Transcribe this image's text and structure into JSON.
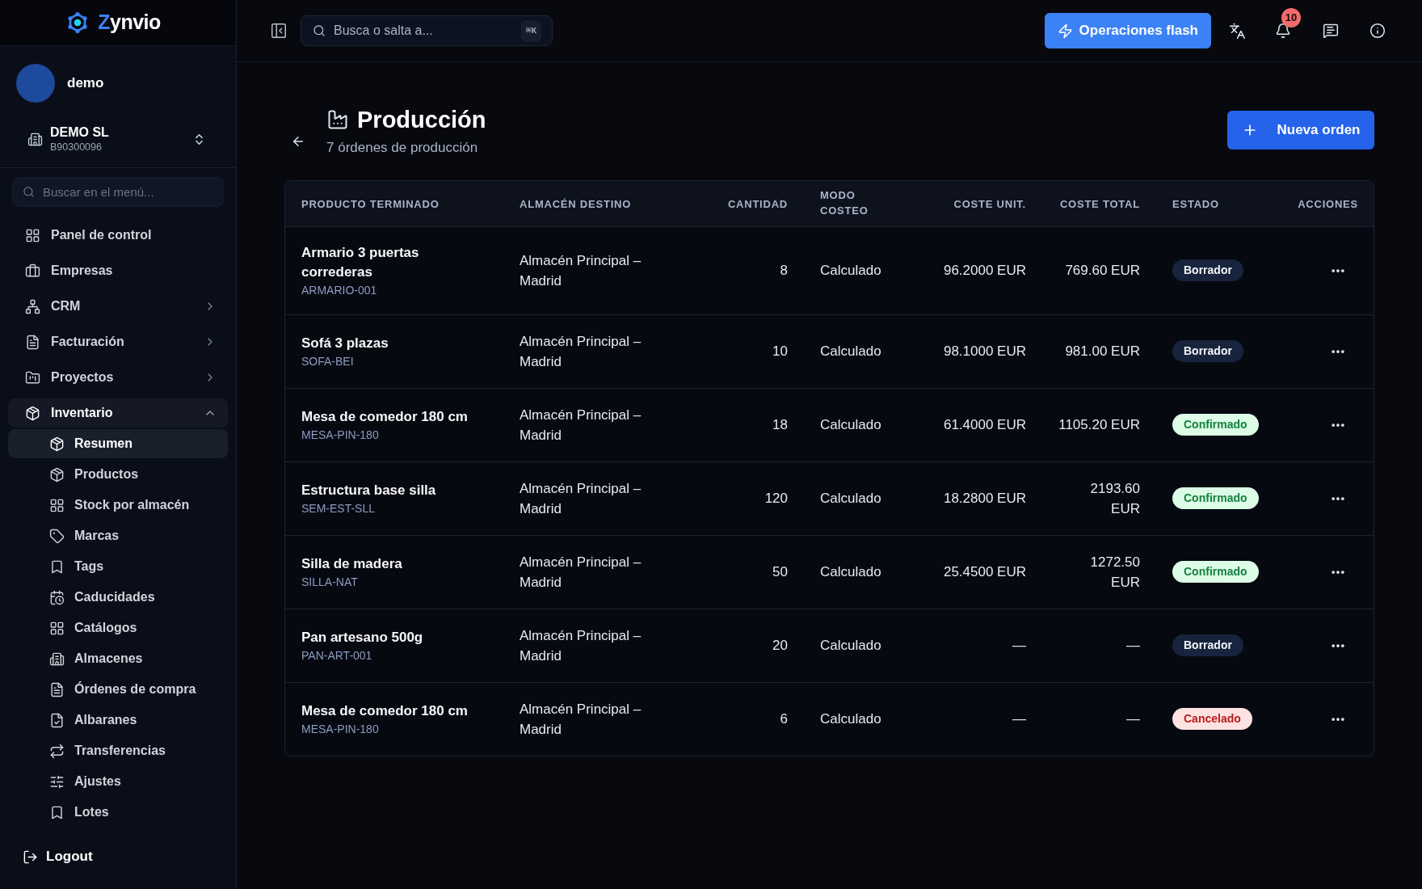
{
  "sidebar": {
    "logo": {
      "accent": "Z",
      "rest": "ynvio"
    },
    "user": {
      "name": "demo"
    },
    "company": {
      "name": "DEMO SL",
      "tax_id": "B90300096"
    },
    "search": {
      "placeholder": "Buscar en el menú..."
    },
    "items": [
      {
        "label": "Panel de control",
        "selected": false
      },
      {
        "label": "Empresas",
        "selected": false
      },
      {
        "label": "CRM",
        "selected": false,
        "expanded": false
      },
      {
        "label": "Facturación",
        "selected": false,
        "expanded": false
      },
      {
        "label": "Proyectos",
        "selected": false,
        "expanded": false
      },
      {
        "label": "Inventario",
        "selected": true,
        "expanded": true,
        "children": [
          {
            "label": "Resumen",
            "selected": true
          },
          {
            "label": "Productos",
            "selected": false
          },
          {
            "label": "Stock por almacén",
            "selected": false
          },
          {
            "label": "Marcas",
            "selected": false
          },
          {
            "label": "Tags",
            "selected": false
          },
          {
            "label": "Caducidades",
            "selected": false
          },
          {
            "label": "Catálogos",
            "selected": false
          },
          {
            "label": "Almacenes",
            "selected": false
          },
          {
            "label": "Órdenes de compra",
            "selected": false
          },
          {
            "label": "Albaranes",
            "selected": false
          },
          {
            "label": "Transferencias",
            "selected": false
          },
          {
            "label": "Ajustes",
            "selected": false
          },
          {
            "label": "Lotes",
            "selected": false
          }
        ]
      }
    ],
    "logout": "Logout"
  },
  "topbar": {
    "search": {
      "placeholder": "Busca o salta a...",
      "shortcut": "⌘K"
    },
    "flash_button": "Operaciones flash",
    "notifications": {
      "count": "10"
    }
  },
  "page": {
    "title": "Producción",
    "subtitle": "7 órdenes de producción",
    "new_button": "Nueva orden"
  },
  "table": {
    "columns": [
      "PRODUCTO TERMINADO",
      "ALMACÉN DESTINO",
      "CANTIDAD",
      "MODO COSTEO",
      "COSTE UNIT.",
      "COSTE TOTAL",
      "ESTADO",
      "ACCIONES"
    ],
    "rows": [
      {
        "product": "Armario 3 puertas correderas",
        "sku": "ARMARIO-001",
        "warehouse": "Almacén Principal – Madrid",
        "quantity": "8",
        "costing_mode": "Calculado",
        "unit_cost": "96.2000 EUR",
        "total_cost": "769.60 EUR",
        "status": {
          "label": "Borrador",
          "kind": "draft"
        }
      },
      {
        "product": "Sofá 3 plazas",
        "sku": "SOFA-BEI",
        "warehouse": "Almacén Principal – Madrid",
        "quantity": "10",
        "costing_mode": "Calculado",
        "unit_cost": "98.1000 EUR",
        "total_cost": "981.00 EUR",
        "status": {
          "label": "Borrador",
          "kind": "draft"
        }
      },
      {
        "product": "Mesa de comedor 180 cm",
        "sku": "MESA-PIN-180",
        "warehouse": "Almacén Principal – Madrid",
        "quantity": "18",
        "costing_mode": "Calculado",
        "unit_cost": "61.4000 EUR",
        "total_cost": "1105.20 EUR",
        "status": {
          "label": "Confirmado",
          "kind": "confirmed"
        }
      },
      {
        "product": "Estructura base silla",
        "sku": "SEM-EST-SLL",
        "warehouse": "Almacén Principal – Madrid",
        "quantity": "120",
        "costing_mode": "Calculado",
        "unit_cost": "18.2800 EUR",
        "total_cost": "2193.60 EUR",
        "status": {
          "label": "Confirmado",
          "kind": "confirmed"
        }
      },
      {
        "product": "Silla de madera",
        "sku": "SILLA-NAT",
        "warehouse": "Almacén Principal – Madrid",
        "quantity": "50",
        "costing_mode": "Calculado",
        "unit_cost": "25.4500 EUR",
        "total_cost": "1272.50 EUR",
        "status": {
          "label": "Confirmado",
          "kind": "confirmed"
        }
      },
      {
        "product": "Pan artesano 500g",
        "sku": "PAN-ART-001",
        "warehouse": "Almacén Principal – Madrid",
        "quantity": "20",
        "costing_mode": "Calculado",
        "unit_cost": "—",
        "total_cost": "—",
        "status": {
          "label": "Borrador",
          "kind": "draft"
        }
      },
      {
        "product": "Mesa de comedor 180 cm",
        "sku": "MESA-PIN-180",
        "warehouse": "Almacén Principal – Madrid",
        "quantity": "6",
        "costing_mode": "Calculado",
        "unit_cost": "—",
        "total_cost": "—",
        "status": {
          "label": "Cancelado",
          "kind": "cancelled"
        }
      }
    ]
  }
}
